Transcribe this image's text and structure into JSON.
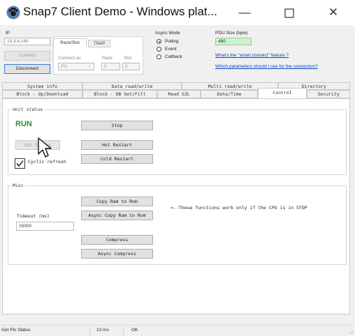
{
  "window": {
    "title": "Snap7 Client Demo - Windows plat...",
    "min_glyph": "—",
    "max_glyph": "☐",
    "close_glyph": "✕"
  },
  "connection": {
    "ip_label": "IP",
    "ip_value": "10.3.4.145",
    "connect_label": "Connect",
    "disconnect_label": "Disconnect",
    "tabs": [
      "Rack/Slot",
      "TSAP"
    ],
    "connect_as_label": "Connect as",
    "connect_as_value": "PG",
    "rack_label": "Rack",
    "rack_value": "0",
    "slot_label": "Slot",
    "slot_value": "2"
  },
  "async_mode": {
    "label": "Async Mode",
    "options": [
      "Polling",
      "Event",
      "Callback"
    ],
    "selected": "Polling"
  },
  "pdu": {
    "label": "PDU Size (byte)",
    "value": "480",
    "link1": "What's the \"smart connect\" feature ?",
    "link2": "Which parameters should I use for the connection?"
  },
  "tabs_row1": [
    "System info",
    "Data read/write",
    "Multi read/write",
    "Directory"
  ],
  "tabs_row2": [
    "Block - Up/Download",
    "Block - DB Get/Fill",
    "Read SZL",
    "Date/Time",
    "Control",
    "Security"
  ],
  "active_tab": "Control",
  "unit_status": {
    "title": "Unit status",
    "status": "RUN",
    "stop_label": "Stop",
    "get_status_label": "Get Status",
    "hot_restart_label": "Hot Restart",
    "cold_restart_label": "Cold Restart",
    "cyclic_label": "Cyclic refresh",
    "cyclic_checked": true
  },
  "misc": {
    "title": "Misc",
    "copy_ram_label": "Copy Ram to Rom",
    "async_copy_label": "Async Copy Ram to Rom",
    "note": "<--These functions work only if the CPU is in STOP",
    "timeout_label": "Timeout (ms)",
    "timeout_value": "15000",
    "compress_label": "Compress",
    "async_compress_label": "Async Compress"
  },
  "statusbar": {
    "text": "Get Plc Status",
    "time": "13 ms",
    "result": "OK"
  },
  "colors": {
    "run_green": "#2e8b2e",
    "pdu_bg": "#c8f5c8",
    "link_blue": "#0a3fc4"
  }
}
